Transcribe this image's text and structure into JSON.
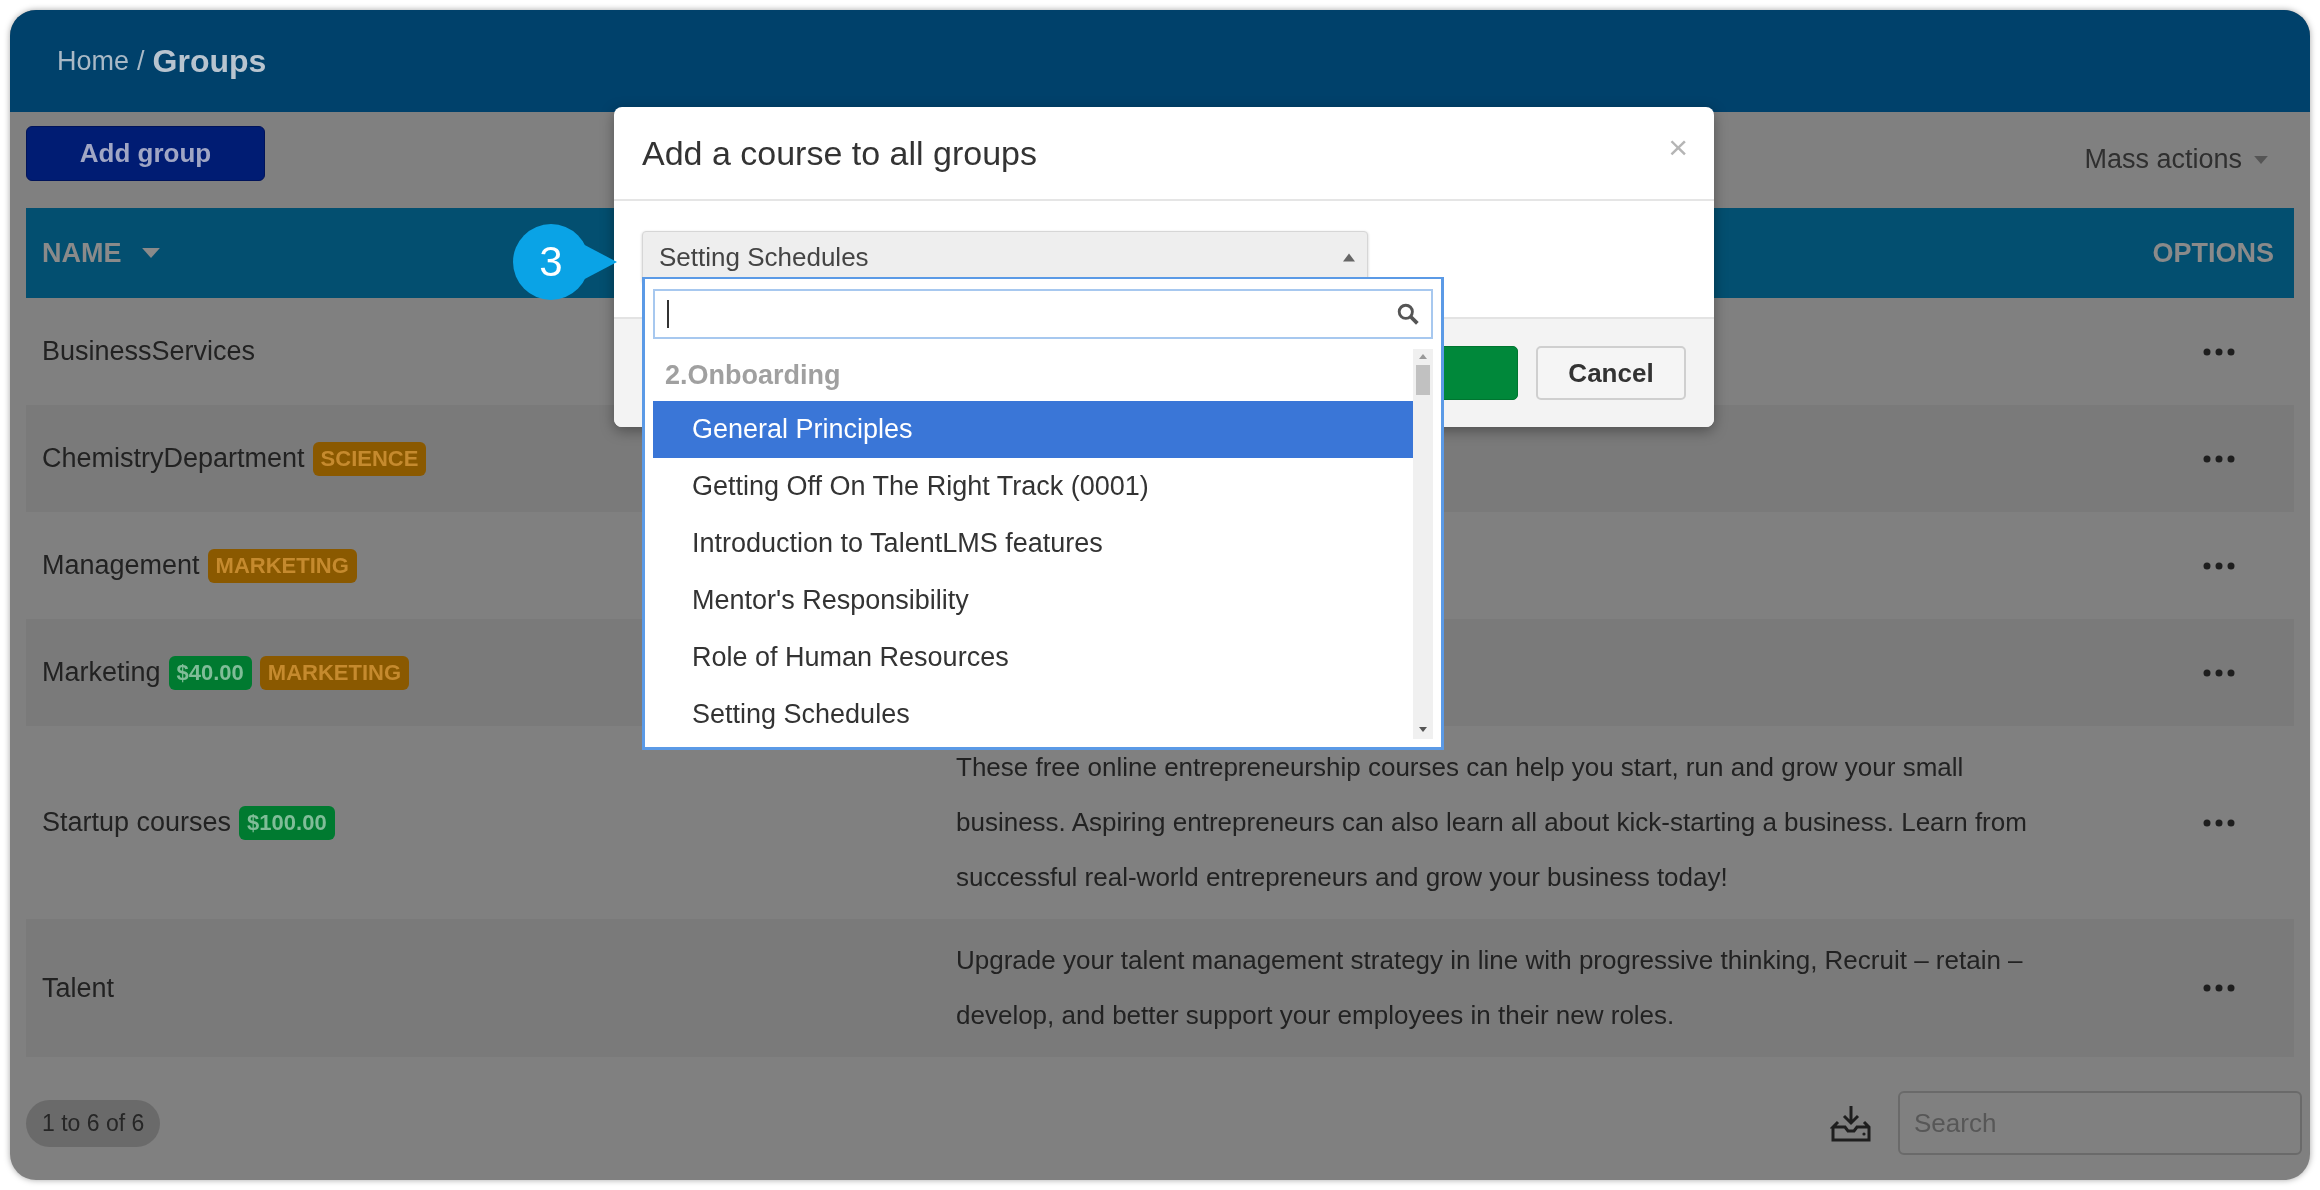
{
  "breadcrumb": {
    "parent": "Home",
    "separator": "/",
    "current": "Groups"
  },
  "add_button": "Add group",
  "mass_actions": "Mass actions",
  "table": {
    "columns": [
      {
        "label": "NAME",
        "sorted": true
      },
      {
        "label": "OPTIONS",
        "sorted": false
      }
    ],
    "rows": [
      {
        "name": "BusinessServices"
      },
      {
        "name": "ChemistryDepartment",
        "tags": [
          {
            "label": "SCIENCE",
            "kind": "category"
          }
        ]
      },
      {
        "name": "Management",
        "tags": [
          {
            "label": "MARKETING",
            "kind": "category"
          }
        ]
      },
      {
        "name": "Marketing",
        "tags": [
          {
            "label": "$40.00",
            "kind": "price"
          },
          {
            "label": "MARKETING",
            "kind": "category"
          }
        ]
      },
      {
        "name": "Startup courses",
        "tags": [
          {
            "label": "$100.00",
            "kind": "price"
          }
        ],
        "description": "These free online entrepreneurship courses can help you start, run and grow your small business. Aspiring entrepreneurs can also learn all about kick-starting a business. Learn from successful real-world entrepreneurs and grow your business today!"
      },
      {
        "name": "Talent",
        "description": "Upgrade your talent management strategy in line with progressive thinking, Recruit – retain – develop, and better support your employees in their new roles."
      }
    ]
  },
  "pagination": "1 to 6 of 6",
  "search": {
    "placeholder": "Search"
  },
  "modal": {
    "title": "Add a course to all groups",
    "close": "×",
    "select": {
      "value": "Setting Schedules",
      "open": true
    },
    "dropdown": {
      "groups": [
        {
          "label": "2.Onboarding",
          "options": [
            {
              "label": "General Principles",
              "selected": true
            },
            {
              "label": "Getting Off On The Right Track (0001)",
              "selected": false
            },
            {
              "label": "Introduction to TalentLMS features",
              "selected": false
            },
            {
              "label": "Mentor's Responsibility",
              "selected": false
            },
            {
              "label": "Role of Human Resources",
              "selected": false
            },
            {
              "label": "Setting Schedules",
              "selected": false
            }
          ]
        }
      ]
    },
    "buttons": [
      {
        "kind": "primary"
      },
      {
        "kind": "secondary",
        "label": "Cancel"
      }
    ]
  },
  "callout": {
    "number": "3"
  }
}
